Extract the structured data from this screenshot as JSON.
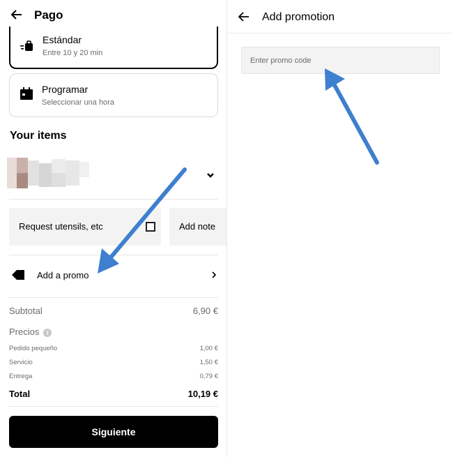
{
  "left": {
    "header": {
      "title": "Pago"
    },
    "delivery_options": [
      {
        "title": "Estándar",
        "subtitle": "Entre 10 y 20 min",
        "selected": true,
        "icon": "bag-icon"
      },
      {
        "title": "Programar",
        "subtitle": "Seleccionar una hora",
        "selected": false,
        "icon": "calendar-icon"
      }
    ],
    "items_section": {
      "title": "Your items"
    },
    "chips": {
      "utensils": "Request utensils, etc",
      "note": "Add note"
    },
    "promo": {
      "label": "Add a promo"
    },
    "summary": {
      "subtotal_label": "Subtotal",
      "subtotal_value": "6,90 €",
      "precios_label": "Precios",
      "info_glyph": "i",
      "fees": [
        {
          "label": "Pedido pequeño",
          "value": "1,00 €"
        },
        {
          "label": "Servicio",
          "value": "1,50 €"
        },
        {
          "label": "Entrega",
          "value": "0,79 €"
        }
      ],
      "total_label": "Total",
      "total_value": "10,19 €"
    },
    "cta": {
      "label": "Siguiente"
    }
  },
  "right": {
    "header": {
      "title": "Add promotion"
    },
    "promo_input": {
      "placeholder": "Enter promo code",
      "value": ""
    }
  },
  "colors": {
    "arrow": "#3f7fcf",
    "cta_bg": "#000000",
    "chip_bg": "#f3f3f3"
  }
}
